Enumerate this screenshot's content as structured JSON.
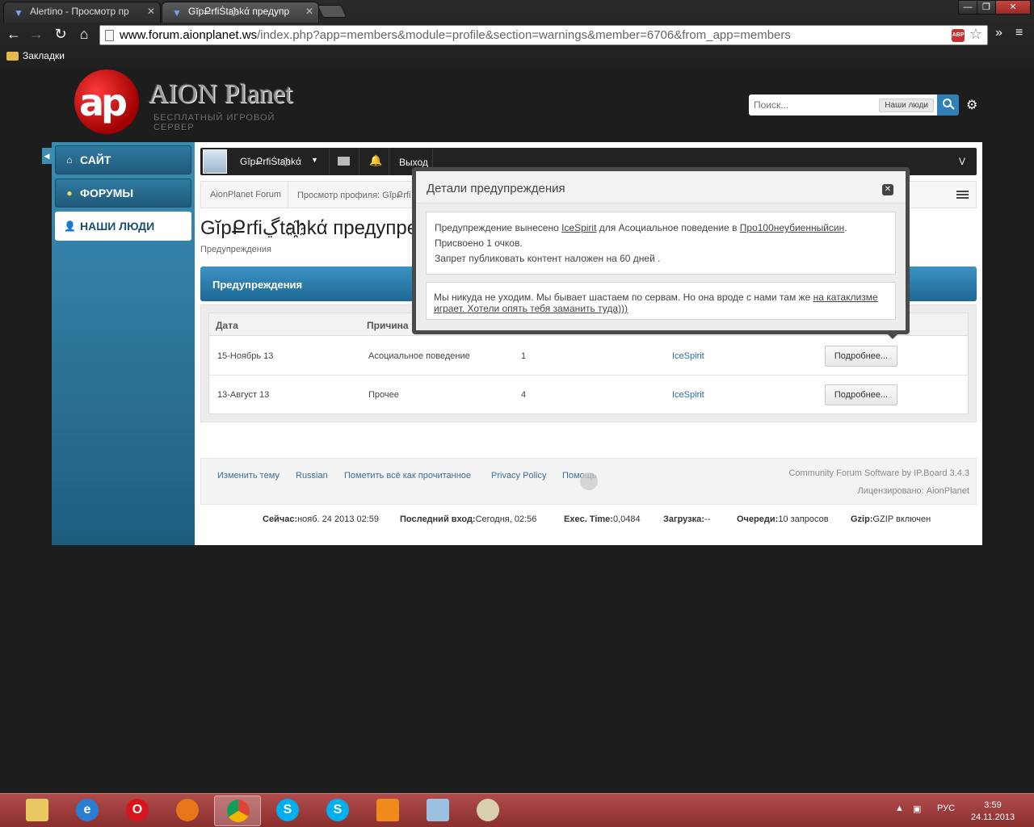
{
  "browser": {
    "tabs": [
      {
        "title": "Alertino - Просмотр пр"
      },
      {
        "title": "GĭpՔrfiṠta҈hkά предупр"
      }
    ],
    "window_controls": {
      "minimize": "—",
      "maximize": "❐",
      "close": "✕"
    },
    "url_host": "www.forum.aionplanet.ws",
    "url_rest": "/index.php?app=members&module=profile&section=warnings&member=6706&from_app=members",
    "abp_label": "ABP",
    "menu_glyph": "»",
    "wrench_glyph": "≡",
    "bookmarks_folder": "Закладки"
  },
  "site": {
    "logo_letters": "ap",
    "logo_title": "AION Planet",
    "logo_subtitle": "БЕСПЛАТНЫЙ ИГРОВОЙ СЕРВЕР",
    "search_placeholder": "Поиск...",
    "search_scope": "Наши люди"
  },
  "sidebar": {
    "items": [
      {
        "label": "САЙТ",
        "icon": "home-icon"
      },
      {
        "label": "ФОРУМЫ",
        "icon": "chat-icon"
      },
      {
        "label": "НАШИ ЛЮДИ",
        "icon": "person-icon",
        "active": true
      }
    ]
  },
  "userbar": {
    "username": "GĭpՔrfiṠta҈hkά",
    "logout": "Выход",
    "right_label": "V"
  },
  "breadcrumb": {
    "home": "AionPlanet Forum",
    "current": "Просмотр профиля: GĭpՔrfiṠta҈hkά"
  },
  "page": {
    "title": "GĭpՔrfiڲta҈hkά предупреждения",
    "description": "Предупреждения",
    "section_header": "Предупреждения"
  },
  "table": {
    "headers": [
      "Дата",
      "Причина"
    ],
    "rows": [
      {
        "date": "15-Ноябрь 13",
        "reason": "Асоциальное поведение",
        "points": "1",
        "moderator": "IceSpirit",
        "button": "Подробнее..."
      },
      {
        "date": "13-Август 13",
        "reason": "Прочее",
        "points": "4",
        "moderator": "IceSpirit",
        "button": "Подробнее..."
      }
    ]
  },
  "footer": {
    "links": [
      "Изменить тему",
      "Russian",
      "Пометить всё как прочитанное",
      "Privacy Policy",
      "Помощь"
    ],
    "software": "Community Forum Software by IP.Board 3.4.3",
    "licensed": "Лицензировано: AionPlanet"
  },
  "stats": {
    "now_label": "Сейчас:",
    "now_value": "нояб. 24 2013 02:59",
    "last_label": "Последний вход:",
    "last_value": "Сегодня, 02:56",
    "exec_label": "Exec. Time:",
    "exec_value": "0,0484",
    "load_label": "Загрузка:",
    "load_value": "--",
    "queue_label": "Очереди:",
    "queue_value": "10 запросов",
    "gzip_label": "Gzip:",
    "gzip_value": "GZIP включен"
  },
  "modal": {
    "title": "Детали предупреждения",
    "line1_a": "Предупреждение вынесено ",
    "line1_user": "IceSpirit",
    "line1_b": " для Асоциальное поведение в ",
    "line1_topic": "Про100неубиенныйсин",
    "line1_c": ".",
    "line2": "Присвоено 1 очков.",
    "line3": "Запрет публиковать контент наложен на 60 дней .",
    "note_a": "Мы никуда не уходим. Мы бывает шастаем по сервам. Но она вроде с нами там же ",
    "note_link1": "на катаклизме",
    "note_link2": "играет. Хотели опять тебя заманить туда)))"
  },
  "taskbar": {
    "lang": "РУС",
    "time": "3:59",
    "date": "24.11.2013",
    "apps": [
      "explorer-icon",
      "ie-icon",
      "opera-icon",
      "firefox-icon",
      "chrome-icon",
      "skype-icon",
      "skype-icon",
      "vlc-icon",
      "installer-icon",
      "paint-icon"
    ]
  }
}
